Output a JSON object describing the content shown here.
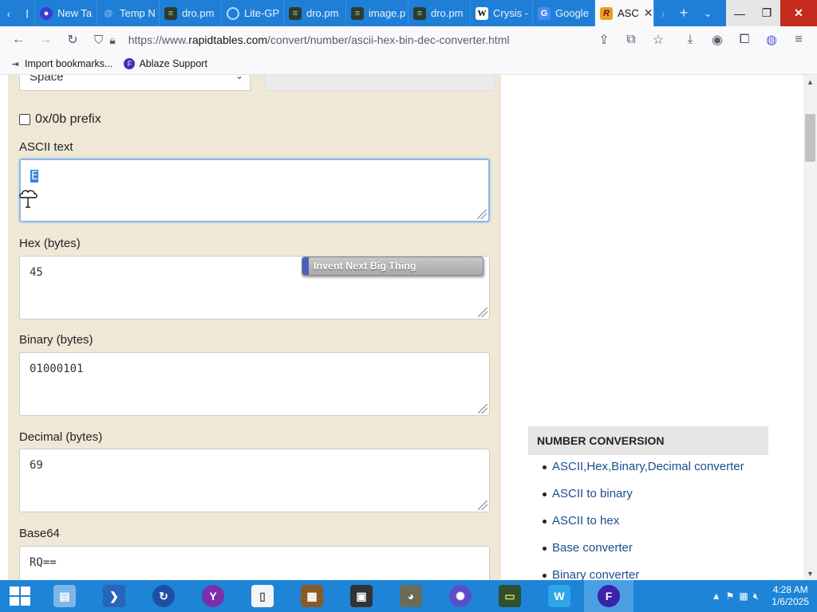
{
  "browser": {
    "tabs": [
      {
        "label": "",
        "icon": "firefox-view-icon"
      },
      {
        "label": "New Ta",
        "icon": "firefox-icon"
      },
      {
        "label": "Temp N",
        "icon": "at-mail-icon"
      },
      {
        "label": "dro.pm",
        "icon": "dropm-icon"
      },
      {
        "label": "Lite-GP",
        "icon": "lite-globe-icon"
      },
      {
        "label": "dro.pm",
        "icon": "dropm-icon"
      },
      {
        "label": "image.p",
        "icon": "dropm-icon"
      },
      {
        "label": "dro.pm",
        "icon": "dropm-icon"
      },
      {
        "label": "Crysis -",
        "icon": "wikipedia-icon"
      },
      {
        "label": "Google",
        "icon": "google-translate-icon"
      },
      {
        "label": "ASC",
        "icon": "rapidtables-icon",
        "active": true
      }
    ],
    "url_prefix": "https://www.",
    "url_domain": "rapidtables.com",
    "url_path": "/convert/number/ascii-hex-bin-dec-converter.html",
    "bookmarks": [
      {
        "label": "Import bookmarks...",
        "icon": "import-icon"
      },
      {
        "label": "Ablaze Support",
        "icon": "ablaze-icon"
      }
    ]
  },
  "converter": {
    "delimiter_value": "Space",
    "prefix_label": "0x/0b prefix",
    "prefix_checked": false,
    "ascii_label": "ASCII text",
    "ascii_value": "E",
    "hex_label": "Hex (bytes)",
    "hex_value": "45",
    "binary_label": "Binary (bytes)",
    "binary_value": "01000101",
    "decimal_label": "Decimal (bytes)",
    "decimal_value": "69",
    "base64_label": "Base64",
    "base64_value": "RQ=="
  },
  "banner": {
    "text": "Invent Next Big Thing"
  },
  "sidebar": {
    "heading": "NUMBER CONVERSION",
    "links": [
      "ASCII,Hex,Binary,Decimal converter",
      "ASCII to binary",
      "ASCII to hex",
      "Base converter",
      "Binary converter"
    ]
  },
  "taskbar": {
    "time": "4:28 AM",
    "date": "1/6/2025"
  },
  "colors": {
    "tab_strip": "#1f7fd6",
    "panel_bg": "#efe8d6",
    "link": "#1a4d8f",
    "taskbar": "#1d84d8",
    "close_btn": "#c42b1c"
  }
}
